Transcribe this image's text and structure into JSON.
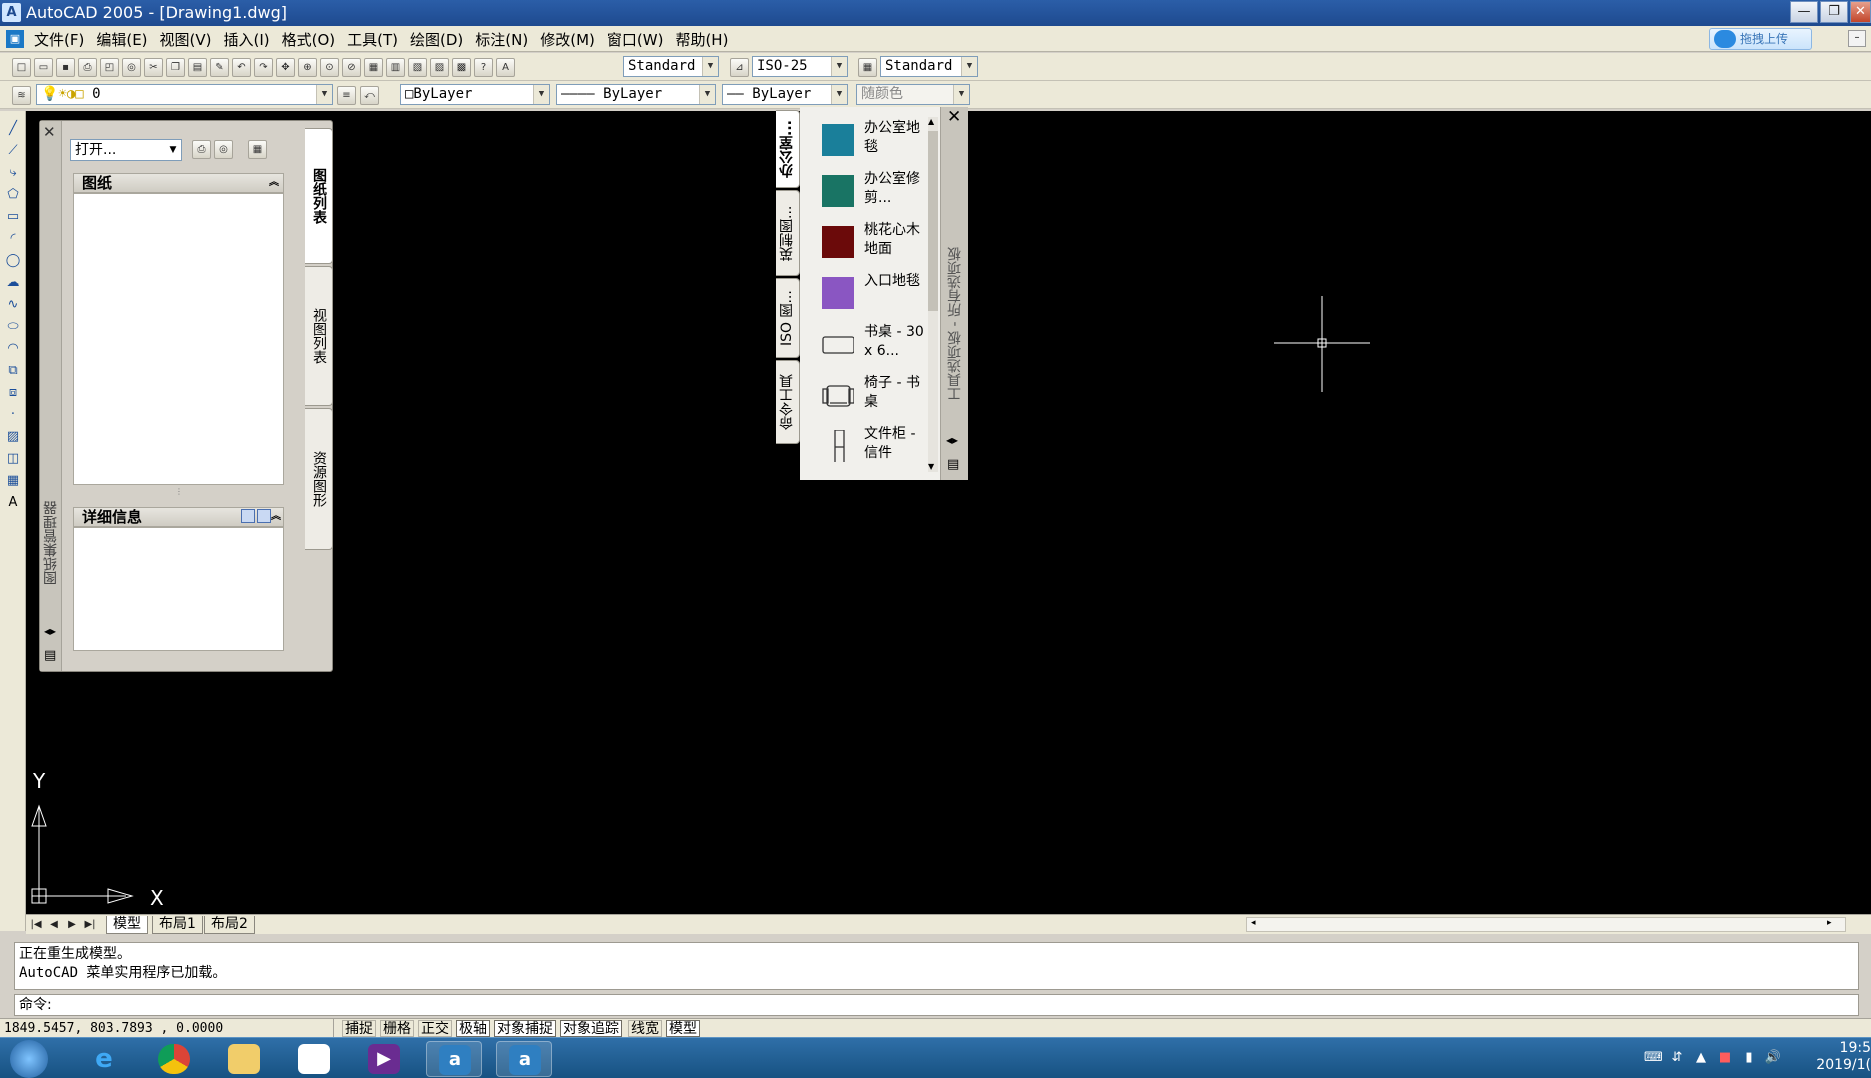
{
  "window": {
    "title": "AutoCAD 2005 - [Drawing1.dwg]",
    "app_icon": "autocad-icon",
    "min_glyph": "—",
    "max_glyph": "❐",
    "close_glyph": "✕"
  },
  "menu": {
    "items": [
      "文件(F)",
      "编辑(E)",
      "视图(V)",
      "插入(I)",
      "格式(O)",
      "工具(T)",
      "绘图(D)",
      "标注(N)",
      "修改(M)",
      "窗口(W)",
      "帮助(H)"
    ],
    "upload_label": "拖拽上传",
    "mini_glyph": "–"
  },
  "toolbar_styles": {
    "text_style": "Standard",
    "dim_style": "ISO-25",
    "table_style": "Standard"
  },
  "toolbar_layers": {
    "layer": "0",
    "color": "□ByLayer",
    "linetype": "———— ByLayer",
    "lineweight": "—— ByLayer",
    "plotstyle": "随颜色"
  },
  "sheet_set_manager": {
    "open_combo": "打开...",
    "section_sheets": "图纸",
    "section_details": "详细信息",
    "side_title": "图纸集管理器",
    "tabs": [
      "图纸列表",
      "视图列表",
      "资源图形"
    ],
    "close_glyph": "✕"
  },
  "tool_palette": {
    "tabs": [
      "办公室...",
      "英制图...",
      "ISO 图...",
      "命令工具"
    ],
    "side_title": "工具选项板 - 所有选项板",
    "close_glyph": "✕",
    "items": [
      {
        "label": "办公室地毯",
        "color": "#1a7f9a",
        "icon": "hatch-swatch-icon"
      },
      {
        "label": "办公室修剪...",
        "color": "#197464",
        "icon": "hatch-swatch-icon"
      },
      {
        "label": "桃花心木地面",
        "color": "#6b0a0a",
        "icon": "hatch-swatch-icon"
      },
      {
        "label": "入口地毯",
        "color": "#8a56c2",
        "icon": "hatch-swatch-icon"
      },
      {
        "label": "书桌 - 30 x 6...",
        "color": "",
        "icon": "desk-block-icon"
      },
      {
        "label": "椅子 - 书桌",
        "color": "",
        "icon": "chair-block-icon"
      },
      {
        "label": "文件柜 - 信件",
        "color": "",
        "icon": "cabinet-block-icon"
      }
    ]
  },
  "ucs": {
    "y_label": "Y",
    "x_label": "X"
  },
  "layout_tabs": [
    "模型",
    "布局1",
    "布局2"
  ],
  "command": {
    "history": [
      "正在重生成模型。",
      "AutoCAD 菜单实用程序已加载。"
    ],
    "prompt": "命令:"
  },
  "status": {
    "coords": "1849.5457, 803.7893 , 0.0000",
    "buttons": [
      "捕捉",
      "栅格",
      "正交",
      "极轴",
      "对象捕捉",
      "对象追踪",
      "线宽",
      "模型"
    ]
  },
  "taskbar": {
    "time": "19:5",
    "date": "2019/1("
  },
  "colors": {
    "accent": "#1e4a8f",
    "canvas": "#000000"
  }
}
